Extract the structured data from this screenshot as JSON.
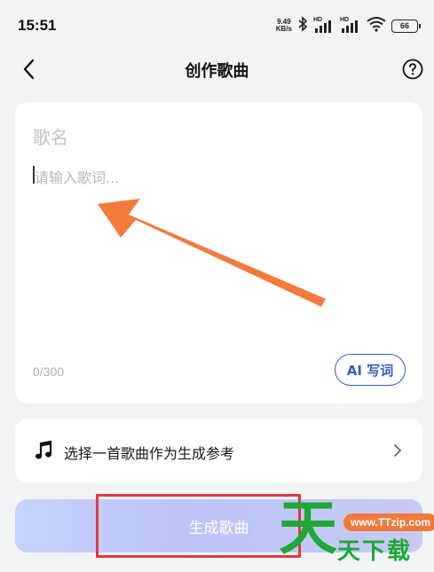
{
  "status_bar": {
    "time": "15:51",
    "net_speed_value": "9.49",
    "net_speed_unit": "KB/s",
    "signal1_tag": "HD",
    "signal2_tag": "HD",
    "battery": "66"
  },
  "nav": {
    "title": "创作歌曲",
    "back_icon": "chevron-left-icon",
    "help_icon": "question-circle-icon"
  },
  "editor": {
    "song_name_placeholder": "歌名",
    "lyrics_placeholder": "请输入歌词...",
    "char_count": "0/300",
    "ai_button_label": "AI 写词"
  },
  "reference": {
    "icon": "music-note-icon",
    "label": "选择一首歌曲作为生成参考",
    "chevron_icon": "chevron-right-icon"
  },
  "generate_button_label": "生成歌曲",
  "watermark": {
    "url": "www.TTzip.com",
    "big_char": "天",
    "sub_text": "天下载"
  },
  "colors": {
    "accent": "#2f5fbf",
    "annotation_arrow": "#f47a3e",
    "annotation_box": "#e23a3a",
    "watermark_green": "#1ea836"
  }
}
